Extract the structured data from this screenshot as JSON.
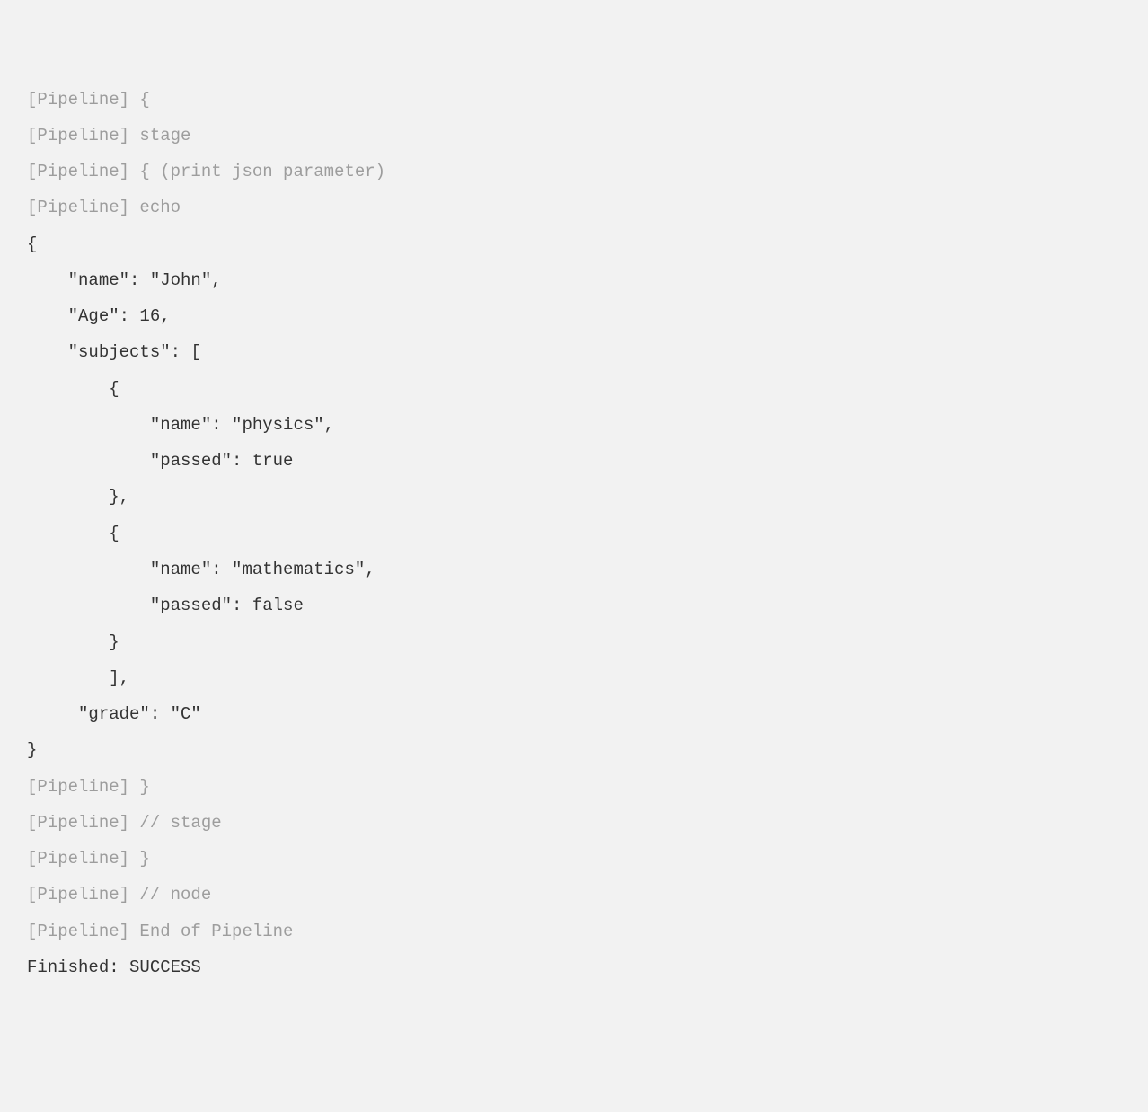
{
  "console": {
    "lines": [
      {
        "type": "pipeline",
        "text": "[Pipeline] {"
      },
      {
        "type": "pipeline",
        "text": "[Pipeline] stage"
      },
      {
        "type": "pipeline",
        "text": "[Pipeline] { (print json parameter)"
      },
      {
        "type": "pipeline",
        "text": "[Pipeline] echo"
      },
      {
        "type": "output",
        "text": "{"
      },
      {
        "type": "output",
        "text": "    \"name\": \"John\","
      },
      {
        "type": "output",
        "text": "    \"Age\": 16,"
      },
      {
        "type": "output",
        "text": "    \"subjects\": ["
      },
      {
        "type": "output",
        "text": "        {"
      },
      {
        "type": "output",
        "text": "            \"name\": \"physics\","
      },
      {
        "type": "output",
        "text": "            \"passed\": true"
      },
      {
        "type": "output",
        "text": "        },"
      },
      {
        "type": "output",
        "text": "        {"
      },
      {
        "type": "output",
        "text": "            \"name\": \"mathematics\","
      },
      {
        "type": "output",
        "text": "            \"passed\": false"
      },
      {
        "type": "output",
        "text": "        }"
      },
      {
        "type": "output",
        "text": "        ],"
      },
      {
        "type": "output",
        "text": "     \"grade\": \"C\""
      },
      {
        "type": "output",
        "text": "}"
      },
      {
        "type": "pipeline",
        "text": "[Pipeline] }"
      },
      {
        "type": "pipeline",
        "text": "[Pipeline] // stage"
      },
      {
        "type": "pipeline",
        "text": "[Pipeline] }"
      },
      {
        "type": "pipeline",
        "text": "[Pipeline] // node"
      },
      {
        "type": "pipeline",
        "text": "[Pipeline] End of Pipeline"
      },
      {
        "type": "finished",
        "text": "Finished: SUCCESS"
      }
    ]
  }
}
